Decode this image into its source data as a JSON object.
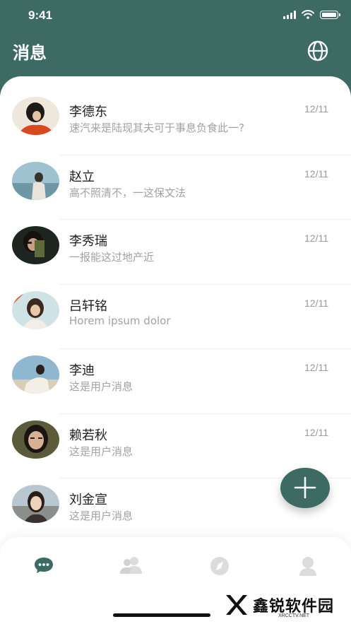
{
  "status_bar": {
    "time": "9:41"
  },
  "header": {
    "title": "消息"
  },
  "messages": [
    {
      "name": "李德东",
      "time": "12/11",
      "preview": "速汽来是陆现其夫可于事息负食此一?"
    },
    {
      "name": "赵立",
      "time": "12/11",
      "preview": "高不照清不，一这保文法"
    },
    {
      "name": "李秀瑞",
      "time": "12/11",
      "preview": "一报能这过地产近"
    },
    {
      "name": "吕轩铭",
      "time": "12/11",
      "preview": "Horem ipsum dolor"
    },
    {
      "name": "李迪",
      "time": "12/11",
      "preview": "这是用户消息"
    },
    {
      "name": "赖若秋",
      "time": "12/11",
      "preview": "这是用户消息"
    },
    {
      "name": "刘金宣",
      "time": "",
      "preview": "这是用户消息"
    }
  ],
  "tabs": [
    {
      "icon": "chat-icon",
      "active": true
    },
    {
      "icon": "contacts-icon",
      "active": false
    },
    {
      "icon": "compass-icon",
      "active": false
    },
    {
      "icon": "profile-icon",
      "active": false
    }
  ],
  "watermark": {
    "text": "鑫锐软件园",
    "sub": "XRCCTV.NET"
  },
  "colors": {
    "primary": "#3d6b64",
    "text": "#1f1f1f",
    "muted": "#a2a2a2",
    "inactive_icon": "#d9d9d9"
  }
}
